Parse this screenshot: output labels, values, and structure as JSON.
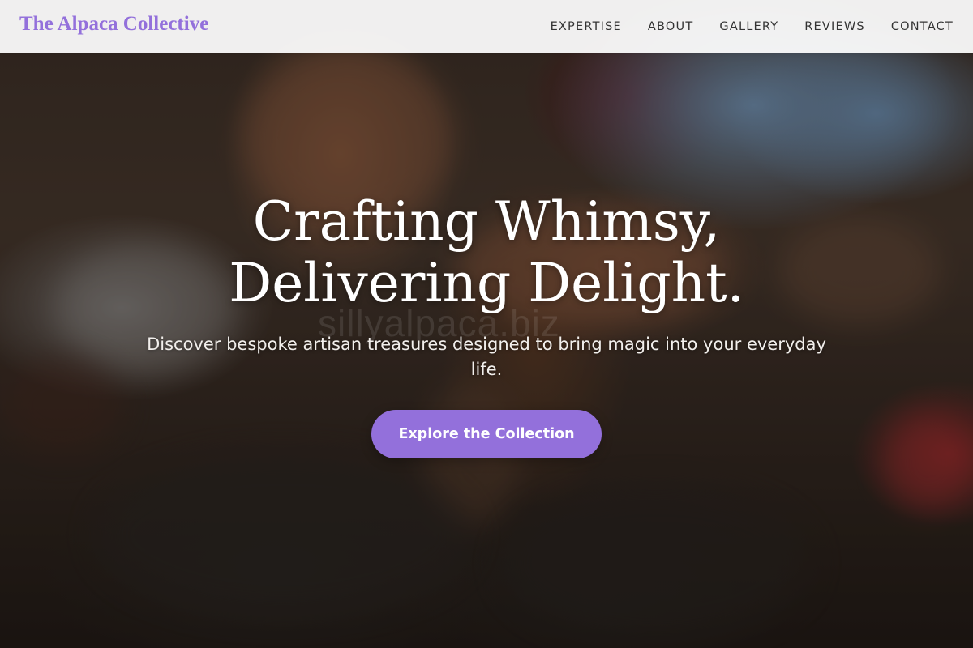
{
  "brand": {
    "name": "The Alpaca Collective",
    "accent_color": "#9370db"
  },
  "nav": {
    "items": [
      {
        "label": "EXPERTISE"
      },
      {
        "label": "ABOUT"
      },
      {
        "label": "GALLERY"
      },
      {
        "label": "REVIEWS"
      },
      {
        "label": "CONTACT"
      }
    ]
  },
  "hero": {
    "headline_line1": "Crafting Whimsy,",
    "headline_line2": "Delivering Delight.",
    "subtext": "Discover bespoke artisan treasures designed to bring magic into your everyday life.",
    "cta_label": "Explore the Collection",
    "watermark": "sillyalpaca.biz"
  }
}
